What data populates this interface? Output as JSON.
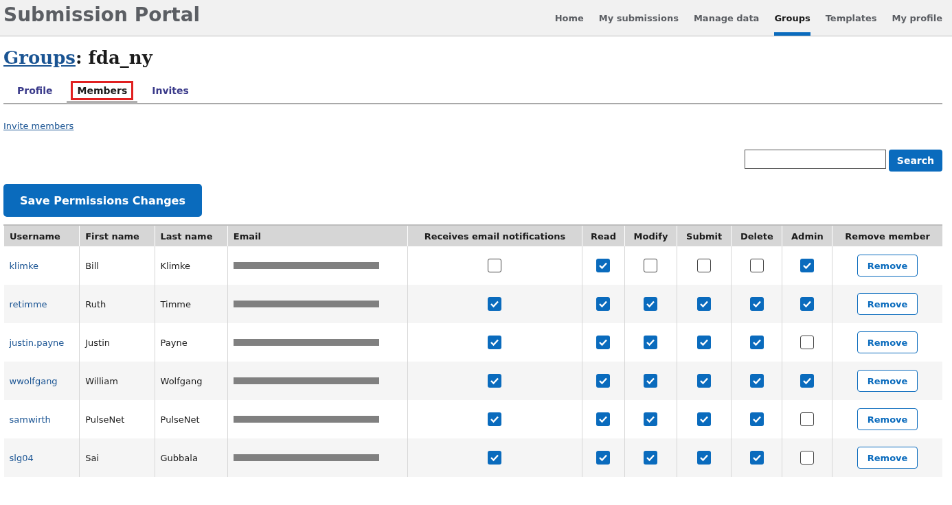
{
  "header": {
    "title": "Submission Portal",
    "nav": [
      {
        "label": "Home",
        "selected": false
      },
      {
        "label": "My submissions",
        "selected": false
      },
      {
        "label": "Manage data",
        "selected": false
      },
      {
        "label": "Groups",
        "selected": true
      },
      {
        "label": "Templates",
        "selected": false
      },
      {
        "label": "My profile",
        "selected": false
      }
    ]
  },
  "page_title": {
    "link": "Groups",
    "name": ": fda_ny"
  },
  "tabs": [
    {
      "label": "Profile",
      "selected": false,
      "highlighted": false
    },
    {
      "label": "Members",
      "selected": true,
      "highlighted": true
    },
    {
      "label": "Invites",
      "selected": false,
      "highlighted": false
    }
  ],
  "invite_link": "Invite members",
  "search": {
    "button": "Search"
  },
  "save_button": "Save Permissions Changes",
  "table": {
    "columns": [
      "Username",
      "First name",
      "Last name",
      "Email",
      "Receives email notifications",
      "Read",
      "Modify",
      "Submit",
      "Delete",
      "Admin",
      "Remove member"
    ],
    "rows": [
      {
        "username": "klimke",
        "first": "Bill",
        "last": "Klimke",
        "notify": false,
        "read": true,
        "modify": false,
        "submit": false,
        "delete": false,
        "admin": true,
        "remove": "Remove"
      },
      {
        "username": "retimme",
        "first": "Ruth",
        "last": "Timme",
        "notify": true,
        "read": true,
        "modify": true,
        "submit": true,
        "delete": true,
        "admin": true,
        "remove": "Remove"
      },
      {
        "username": "justin.payne",
        "first": "Justin",
        "last": "Payne",
        "notify": true,
        "read": true,
        "modify": true,
        "submit": true,
        "delete": true,
        "admin": false,
        "remove": "Remove"
      },
      {
        "username": "wwolfgang",
        "first": "William",
        "last": "Wolfgang",
        "notify": true,
        "read": true,
        "modify": true,
        "submit": true,
        "delete": true,
        "admin": true,
        "remove": "Remove"
      },
      {
        "username": "samwirth",
        "first": "PulseNet",
        "last": "PulseNet",
        "notify": true,
        "read": true,
        "modify": true,
        "submit": true,
        "delete": true,
        "admin": false,
        "remove": "Remove"
      },
      {
        "username": "slg04",
        "first": "Sai",
        "last": "Gubbala",
        "notify": true,
        "read": true,
        "modify": true,
        "submit": true,
        "delete": true,
        "admin": false,
        "remove": "Remove"
      }
    ]
  }
}
